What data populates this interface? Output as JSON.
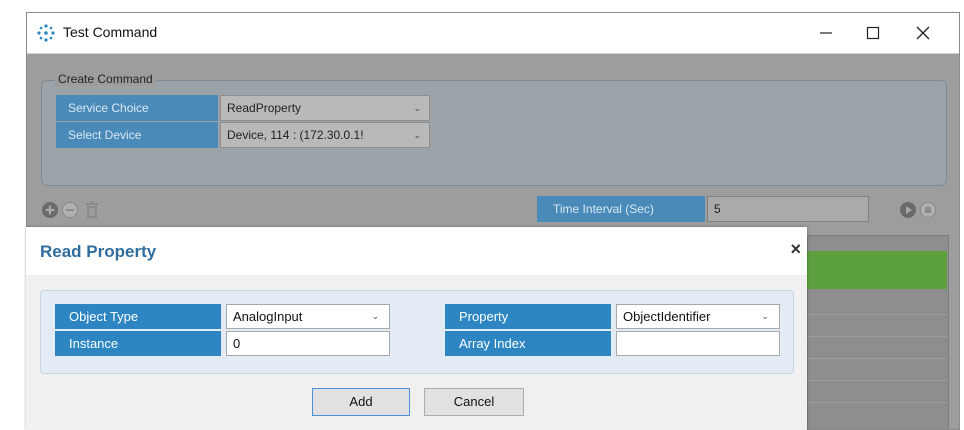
{
  "window": {
    "title": "Test Command",
    "minimize_glyph": "—",
    "maximize_glyph": "☐",
    "close_glyph": "✕"
  },
  "create_command": {
    "legend": "Create Command",
    "service_choice_label": "Service Choice",
    "service_choice_value": "ReadProperty",
    "select_device_label": "Select Device",
    "select_device_value": "Device, 114 : (172.30.0.1!"
  },
  "toolbar": {
    "time_interval_label": "Time Interval (Sec)",
    "time_interval_value": "5"
  },
  "dialog": {
    "title": "Read Property",
    "close_glyph": "×",
    "object_type_label": "Object Type",
    "object_type_value": "AnalogInput",
    "instance_label": "Instance",
    "instance_value": "0",
    "property_label": "Property",
    "property_value": "ObjectIdentifier",
    "array_index_label": "Array Index",
    "array_index_value": "",
    "add_label": "Add",
    "cancel_label": "Cancel"
  },
  "icons": {
    "app_logo": "app-logo-icon",
    "add": "add-circle-icon",
    "remove": "remove-circle-icon",
    "delete": "trash-icon",
    "play": "play-circle-icon",
    "stop": "stop-circle-icon",
    "dropdown": "chevron-down-icon"
  },
  "colors": {
    "label_blue": "#2d86c2",
    "dialog_title": "#2f6d9e",
    "status_green": "#5da13e"
  }
}
